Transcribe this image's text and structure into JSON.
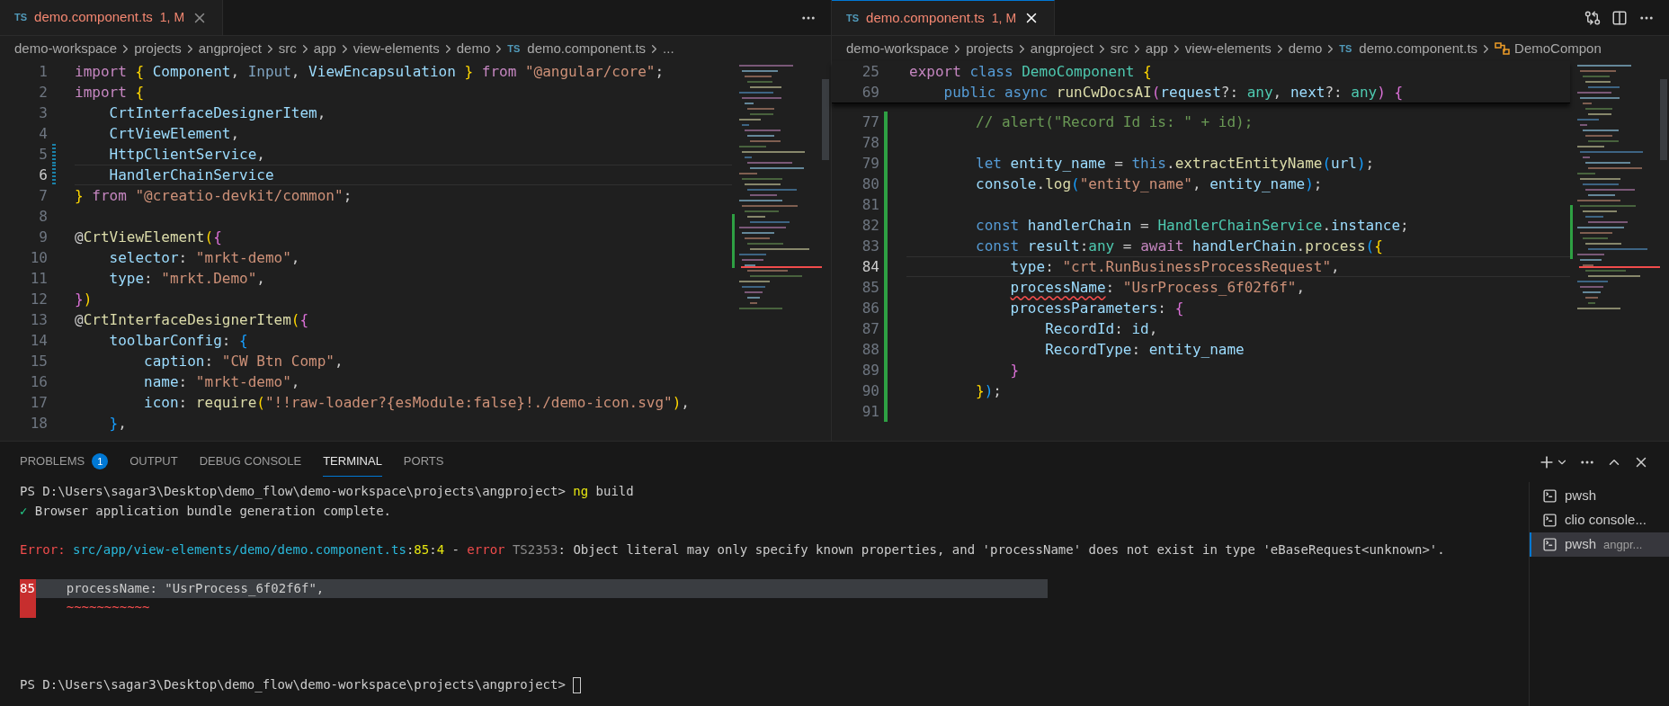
{
  "editors": [
    {
      "tab": {
        "file_type": "TS",
        "title": "demo.component.ts",
        "badge": "1, M",
        "active": false
      },
      "breadcrumbs": [
        {
          "kind": "folder",
          "text": "demo-workspace"
        },
        {
          "kind": "folder",
          "text": "projects"
        },
        {
          "kind": "folder",
          "text": "angproject"
        },
        {
          "kind": "folder",
          "text": "src"
        },
        {
          "kind": "folder",
          "text": "app"
        },
        {
          "kind": "folder",
          "text": "view-elements"
        },
        {
          "kind": "folder",
          "text": "demo"
        },
        {
          "kind": "file",
          "badge": "TS",
          "text": "demo.component.ts"
        },
        {
          "kind": "more",
          "text": "..."
        }
      ],
      "lines": [
        {
          "number": "1",
          "current": false,
          "modified": false,
          "tokens": [
            {
              "kind": "kw",
              "text": "import"
            },
            {
              "kind": "b1",
              "text": " { "
            },
            {
              "kind": "var",
              "text": "Component"
            },
            {
              "kind": "p",
              "text": ", "
            },
            {
              "kind": "dim",
              "text": "Input"
            },
            {
              "kind": "p",
              "text": ", "
            },
            {
              "kind": "var",
              "text": "ViewEncapsulation"
            },
            {
              "kind": "b1",
              "text": " } "
            },
            {
              "kind": "kw",
              "text": "from"
            },
            {
              "kind": "str",
              "text": " \"@angular/core\""
            },
            {
              "kind": "p",
              "text": ";"
            }
          ]
        },
        {
          "number": "2",
          "current": false,
          "modified": false,
          "tokens": [
            {
              "kind": "kw",
              "text": "import"
            },
            {
              "kind": "b1",
              "text": " {"
            }
          ]
        },
        {
          "number": "3",
          "current": false,
          "modified": false,
          "tokens": [
            {
              "kind": "var",
              "text": "    CrtInterfaceDesignerItem"
            },
            {
              "kind": "p",
              "text": ","
            }
          ]
        },
        {
          "number": "4",
          "current": false,
          "modified": false,
          "tokens": [
            {
              "kind": "var",
              "text": "    CrtViewElement"
            },
            {
              "kind": "p",
              "text": ","
            }
          ]
        },
        {
          "number": "5",
          "current": false,
          "modified": true,
          "tokens": [
            {
              "kind": "var",
              "text": "    HttpClientService"
            },
            {
              "kind": "p",
              "text": ","
            }
          ]
        },
        {
          "number": "6",
          "current": true,
          "modified": true,
          "tokens": [
            {
              "kind": "var",
              "text": "    HandlerChainService"
            }
          ]
        },
        {
          "number": "7",
          "current": false,
          "modified": false,
          "tokens": [
            {
              "kind": "b1",
              "text": "} "
            },
            {
              "kind": "kw",
              "text": "from"
            },
            {
              "kind": "str",
              "text": " \"@creatio-devkit/common\""
            },
            {
              "kind": "p",
              "text": ";"
            }
          ]
        },
        {
          "number": "8",
          "current": false,
          "modified": false
        },
        {
          "number": "9",
          "current": false,
          "modified": false,
          "tokens": [
            {
              "kind": "p",
              "text": "@"
            },
            {
              "kind": "fn",
              "text": "CrtViewElement"
            },
            {
              "kind": "b1",
              "text": "("
            },
            {
              "kind": "b2",
              "text": "{"
            }
          ]
        },
        {
          "number": "10",
          "current": false,
          "modified": false,
          "tokens": [
            {
              "kind": "var",
              "text": "    selector"
            },
            {
              "kind": "p",
              "text": ": "
            },
            {
              "kind": "str",
              "text": "\"mrkt-demo\""
            },
            {
              "kind": "p",
              "text": ","
            }
          ]
        },
        {
          "number": "11",
          "current": false,
          "modified": false,
          "tokens": [
            {
              "kind": "var",
              "text": "    type"
            },
            {
              "kind": "p",
              "text": ": "
            },
            {
              "kind": "str",
              "text": "\"mrkt.Demo\""
            },
            {
              "kind": "p",
              "text": ","
            }
          ]
        },
        {
          "number": "12",
          "current": false,
          "modified": false,
          "tokens": [
            {
              "kind": "b2",
              "text": "}"
            },
            {
              "kind": "b1",
              "text": ")"
            }
          ]
        },
        {
          "number": "13",
          "current": false,
          "modified": false,
          "tokens": [
            {
              "kind": "p",
              "text": "@"
            },
            {
              "kind": "fn",
              "text": "CrtInterfaceDesignerItem"
            },
            {
              "kind": "b1",
              "text": "("
            },
            {
              "kind": "b2",
              "text": "{"
            }
          ]
        },
        {
          "number": "14",
          "current": false,
          "modified": false,
          "tokens": [
            {
              "kind": "var",
              "text": "    toolbarConfig"
            },
            {
              "kind": "p",
              "text": ": "
            },
            {
              "kind": "b3",
              "text": "{"
            }
          ]
        },
        {
          "number": "15",
          "current": false,
          "modified": false,
          "tokens": [
            {
              "kind": "var",
              "text": "        caption"
            },
            {
              "kind": "p",
              "text": ": "
            },
            {
              "kind": "str",
              "text": "\"CW Btn Comp\""
            },
            {
              "kind": "p",
              "text": ","
            }
          ]
        },
        {
          "number": "16",
          "current": false,
          "modified": false,
          "tokens": [
            {
              "kind": "var",
              "text": "        name"
            },
            {
              "kind": "p",
              "text": ": "
            },
            {
              "kind": "str",
              "text": "\"mrkt-demo\""
            },
            {
              "kind": "p",
              "text": ","
            }
          ]
        },
        {
          "number": "17",
          "current": false,
          "modified": false,
          "tokens": [
            {
              "kind": "var",
              "text": "        icon"
            },
            {
              "kind": "p",
              "text": ": "
            },
            {
              "kind": "fn",
              "text": "require"
            },
            {
              "kind": "b1",
              "text": "("
            },
            {
              "kind": "str",
              "text": "\"!!raw-loader?{esModule:false}!./demo-icon.svg\""
            },
            {
              "kind": "b1",
              "text": ")"
            },
            {
              "kind": "p",
              "text": ","
            }
          ]
        },
        {
          "number": "18",
          "current": false,
          "modified": false,
          "tokens": [
            {
              "kind": "b3",
              "text": "    }"
            },
            {
              "kind": "p",
              "text": ","
            }
          ]
        }
      ]
    },
    {
      "tab": {
        "file_type": "TS",
        "title": "demo.component.ts",
        "badge": "1, M",
        "active": true
      },
      "breadcrumbs": [
        {
          "kind": "folder",
          "text": "demo-workspace"
        },
        {
          "kind": "folder",
          "text": "projects"
        },
        {
          "kind": "folder",
          "text": "angproject"
        },
        {
          "kind": "folder",
          "text": "src"
        },
        {
          "kind": "folder",
          "text": "app"
        },
        {
          "kind": "folder",
          "text": "view-elements"
        },
        {
          "kind": "folder",
          "text": "demo"
        },
        {
          "kind": "file",
          "badge": "TS",
          "text": "demo.component.ts"
        },
        {
          "kind": "symbol",
          "text": "DemoCompon"
        }
      ],
      "sticky_lines": [
        {
          "number": "25",
          "tokens": [
            {
              "kind": "kw",
              "text": "export"
            },
            {
              "kind": "st",
              "text": " class"
            },
            {
              "kind": "cls",
              "text": " DemoComponent"
            },
            {
              "kind": "b1",
              "text": " {"
            }
          ]
        },
        {
          "number": "69",
          "tokens": [
            {
              "kind": "st",
              "text": "    public async"
            },
            {
              "kind": "fn",
              "text": " runCwDocsAI"
            },
            {
              "kind": "b2",
              "text": "("
            },
            {
              "kind": "var",
              "text": "request"
            },
            {
              "kind": "p",
              "text": "?: "
            },
            {
              "kind": "cls",
              "text": "any"
            },
            {
              "kind": "p",
              "text": ", "
            },
            {
              "kind": "var",
              "text": "next"
            },
            {
              "kind": "p",
              "text": "?: "
            },
            {
              "kind": "cls",
              "text": "any"
            },
            {
              "kind": "b2",
              "text": ")"
            },
            {
              "kind": "b2",
              "text": " {"
            }
          ]
        }
      ],
      "lines": [
        {
          "number": "77",
          "current": false,
          "modified": false,
          "added": true,
          "tokens": [
            {
              "kind": "com",
              "text": "        // alert(\"Record Id is: \" + id);"
            }
          ]
        },
        {
          "number": "78",
          "current": false,
          "modified": false,
          "added": true
        },
        {
          "number": "79",
          "current": false,
          "modified": false,
          "added": true,
          "tokens": [
            {
              "kind": "st",
              "text": "        let"
            },
            {
              "kind": "var",
              "text": " entity_name"
            },
            {
              "kind": "p",
              "text": " = "
            },
            {
              "kind": "st",
              "text": "this"
            },
            {
              "kind": "p",
              "text": "."
            },
            {
              "kind": "fn",
              "text": "extractEntityName"
            },
            {
              "kind": "b3",
              "text": "("
            },
            {
              "kind": "var",
              "text": "url"
            },
            {
              "kind": "b3",
              "text": ")"
            },
            {
              "kind": "p",
              "text": ";"
            }
          ]
        },
        {
          "number": "80",
          "current": false,
          "modified": false,
          "added": true,
          "tokens": [
            {
              "kind": "var",
              "text": "        console"
            },
            {
              "kind": "p",
              "text": "."
            },
            {
              "kind": "fn",
              "text": "log"
            },
            {
              "kind": "b3",
              "text": "("
            },
            {
              "kind": "str",
              "text": "\"entity_name\""
            },
            {
              "kind": "p",
              "text": ", "
            },
            {
              "kind": "var",
              "text": "entity_name"
            },
            {
              "kind": "b3",
              "text": ")"
            },
            {
              "kind": "p",
              "text": ";"
            }
          ]
        },
        {
          "number": "81",
          "current": false,
          "modified": false,
          "added": true
        },
        {
          "number": "82",
          "current": false,
          "modified": false,
          "added": true,
          "tokens": [
            {
              "kind": "st",
              "text": "        const"
            },
            {
              "kind": "var",
              "text": " handlerChain"
            },
            {
              "kind": "p",
              "text": " = "
            },
            {
              "kind": "cls",
              "text": "HandlerChainService"
            },
            {
              "kind": "p",
              "text": "."
            },
            {
              "kind": "var",
              "text": "instance"
            },
            {
              "kind": "p",
              "text": ";"
            }
          ]
        },
        {
          "number": "83",
          "current": false,
          "modified": false,
          "added": true,
          "tokens": [
            {
              "kind": "st",
              "text": "        const"
            },
            {
              "kind": "var",
              "text": " result"
            },
            {
              "kind": "p",
              "text": ":"
            },
            {
              "kind": "cls",
              "text": "any"
            },
            {
              "kind": "p",
              "text": " = "
            },
            {
              "kind": "kw",
              "text": "await"
            },
            {
              "kind": "var",
              "text": " handlerChain"
            },
            {
              "kind": "p",
              "text": "."
            },
            {
              "kind": "fn",
              "text": "process"
            },
            {
              "kind": "b3",
              "text": "("
            },
            {
              "kind": "b1",
              "text": "{"
            }
          ]
        },
        {
          "number": "84",
          "current": true,
          "modified": false,
          "added": true,
          "tokens": [
            {
              "kind": "var",
              "text": "            type"
            },
            {
              "kind": "p",
              "text": ": "
            },
            {
              "kind": "str",
              "text": "\"crt.RunBusinessProcessRequest\""
            },
            {
              "kind": "p",
              "text": ","
            }
          ]
        },
        {
          "number": "85",
          "current": false,
          "modified": false,
          "added": true,
          "tokens": [
            {
              "kind": "err",
              "text": "            processName"
            },
            {
              "kind": "p",
              "text": ": "
            },
            {
              "kind": "str",
              "text": "\"UsrProcess_6f02f6f\""
            },
            {
              "kind": "p",
              "text": ","
            }
          ]
        },
        {
          "number": "86",
          "current": false,
          "modified": false,
          "added": true,
          "tokens": [
            {
              "kind": "var",
              "text": "            processParameters"
            },
            {
              "kind": "p",
              "text": ": "
            },
            {
              "kind": "b2",
              "text": "{"
            }
          ]
        },
        {
          "number": "87",
          "current": false,
          "modified": false,
          "added": true,
          "tokens": [
            {
              "kind": "var",
              "text": "                RecordId"
            },
            {
              "kind": "p",
              "text": ": "
            },
            {
              "kind": "var",
              "text": "id"
            },
            {
              "kind": "p",
              "text": ","
            }
          ]
        },
        {
          "number": "88",
          "current": false,
          "modified": false,
          "added": true,
          "tokens": [
            {
              "kind": "var",
              "text": "                RecordType"
            },
            {
              "kind": "p",
              "text": ": "
            },
            {
              "kind": "var",
              "text": "entity_name"
            }
          ]
        },
        {
          "number": "89",
          "current": false,
          "modified": false,
          "added": true,
          "tokens": [
            {
              "kind": "b2",
              "text": "            }"
            }
          ]
        },
        {
          "number": "90",
          "current": false,
          "modified": false,
          "added": true,
          "tokens": [
            {
              "kind": "b1",
              "text": "        }"
            },
            {
              "kind": "b3",
              "text": ")"
            },
            {
              "kind": "p",
              "text": ";"
            }
          ]
        },
        {
          "number": "91",
          "current": false,
          "modified": false,
          "added": true
        }
      ]
    }
  ],
  "panel": {
    "tabs": [
      {
        "label": "PROBLEMS",
        "badge": "1",
        "selected": false
      },
      {
        "label": "OUTPUT",
        "selected": false
      },
      {
        "label": "DEBUG CONSOLE",
        "selected": false
      },
      {
        "label": "TERMINAL",
        "selected": true
      },
      {
        "label": "PORTS",
        "selected": false
      }
    ],
    "terminal": [
      {
        "kind": "text",
        "parts": [
          {
            "kind": "white",
            "text": "PS D:\\Users\\sagar3\\Desktop\\demo_flow\\demo-workspace\\projects\\angproject> "
          },
          {
            "kind": "yellow",
            "text": "ng"
          },
          {
            "kind": "white",
            "text": " build"
          }
        ]
      },
      {
        "kind": "text",
        "parts": [
          {
            "kind": "green",
            "text": "✓"
          },
          {
            "kind": "white",
            "text": " Browser application bundle generation complete."
          }
        ]
      },
      {
        "kind": "blank"
      },
      {
        "kind": "text",
        "parts": [
          {
            "kind": "red",
            "text": "Error: "
          },
          {
            "kind": "cyan",
            "text": "src/app/view-elements/demo/demo.component.ts"
          },
          {
            "kind": "white",
            "text": ":"
          },
          {
            "kind": "yellow",
            "text": "85"
          },
          {
            "kind": "white",
            "text": ":"
          },
          {
            "kind": "yellow",
            "text": "4"
          },
          {
            "kind": "white",
            "text": " - "
          },
          {
            "kind": "red",
            "text": "error"
          },
          {
            "kind": "grey",
            "text": " TS2353"
          },
          {
            "kind": "white",
            "text": ": Object literal may only specify known properties, and 'processName' does not exist in type 'eBaseRequest<unknown>'."
          }
        ]
      },
      {
        "kind": "blank"
      },
      {
        "kind": "excerpt",
        "number": "85",
        "text": "    processName: \"UsrProcess_6f02f6f\","
      },
      {
        "kind": "marker",
        "text": "    ~~~~~~~~~~~"
      },
      {
        "kind": "blank"
      },
      {
        "kind": "blank"
      },
      {
        "kind": "blank"
      },
      {
        "kind": "prompt_cursor",
        "parts": [
          {
            "kind": "white",
            "text": "PS D:\\Users\\sagar3\\Desktop\\demo_flow\\demo-workspace\\projects\\angproject> "
          }
        ]
      }
    ],
    "instances": [
      {
        "name": "pwsh",
        "selected": false
      },
      {
        "name": "clio console...",
        "selected": false
      },
      {
        "name": "pwsh",
        "detail": "angpr...",
        "selected": true
      }
    ]
  }
}
